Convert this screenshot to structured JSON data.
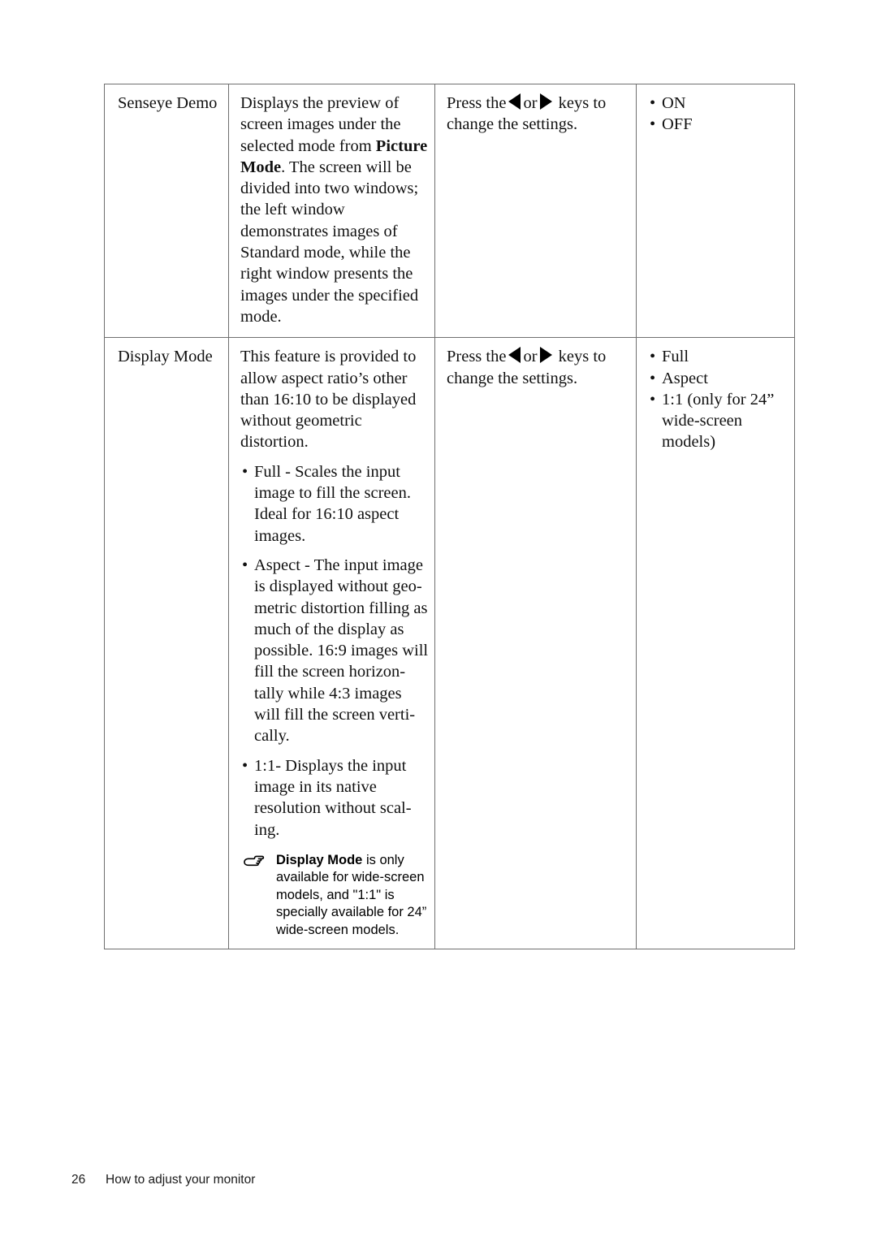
{
  "page": {
    "number": "26",
    "footer_title": "How to adjust your monitor"
  },
  "table": {
    "rows": [
      {
        "name": "Senseye Demo",
        "description": {
          "intro_part1": "Displays the preview of screen images under the selected mode from ",
          "intro_bold": "Picture Mode",
          "intro_part2": ". The screen will be divided into two windows; the left window demonstrates images of Standard mode, while the right window presents the images under the specified mode."
        },
        "action": {
          "prefix": "Press the",
          "middle": "or",
          "suffix": "keys to change the settings.",
          "left_key_icon": "arrow-left-icon",
          "right_key_icon": "arrow-right-icon"
        },
        "options": [
          "ON",
          "OFF"
        ]
      },
      {
        "name": "Display Mode",
        "description": {
          "intro": "This feature is provided to allow aspect ratio’s other than 16:10 to be displayed without geometric distortion.",
          "bullets": [
            "Full - Scales the input image to fill the screen. Ideal for 16:10 aspect images.",
            "Aspect - The input image is displayed without geo-metric distortion filling as much of the display as possible. 16:9 images will fill the screen horizon-tally while 4:3 images will fill the screen verti-cally.",
            "1:1- Displays the input image in its native resolution without scal-ing."
          ],
          "note": {
            "icon": "pointing-hand-icon",
            "bold_lead": "Display Mode",
            "text": " is only available for wide-screen models, and \"1:1\" is specially available for 24” wide-screen models."
          }
        },
        "action": {
          "prefix": "Press the",
          "middle": "or",
          "suffix": "keys to change the settings.",
          "left_key_icon": "arrow-left-icon",
          "right_key_icon": "arrow-right-icon"
        },
        "options": [
          "Full",
          "Aspect",
          "1:1 (only for 24” wide-screen models)"
        ]
      }
    ]
  },
  "colors": {
    "text": "#111111",
    "border": "#6f6f6f",
    "background": "#ffffff"
  }
}
